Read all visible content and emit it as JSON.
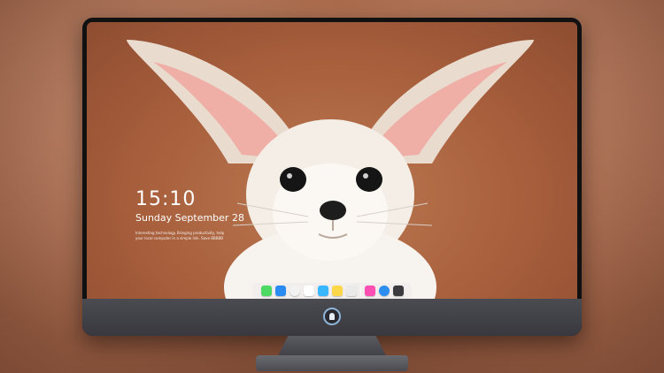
{
  "lock_screen": {
    "time": "15:10",
    "date": "Sunday September 28",
    "note_lines": [
      "Interesting technology. Bringing productivity, help",
      "your local computer in a simple link. Save BBBBB"
    ]
  },
  "dock": {
    "apps": [
      {
        "name": "messages-icon",
        "color": "#4cd964"
      },
      {
        "name": "files-icon",
        "color": "#2a8cf0"
      },
      {
        "name": "safari-icon",
        "color": "#f2f2f2"
      },
      {
        "name": "calendar-icon",
        "color": "#ffffff"
      },
      {
        "name": "photos-icon",
        "color": "#38b6ff"
      },
      {
        "name": "notes-icon",
        "color": "#ffd84a"
      },
      {
        "name": "app-store-icon",
        "color": "#eaeaea"
      },
      {
        "name": "music-icon",
        "color": "#ff4fb2"
      },
      {
        "name": "browser-icon",
        "color": "#2e8ef0"
      },
      {
        "name": "camera-icon",
        "color": "#3b3b3f"
      }
    ]
  },
  "colors": {
    "background": "#a9694a",
    "monitor_body": "#38383e",
    "fox_fur": "#f4eee6",
    "ear_inner": "#f0a7a0"
  }
}
